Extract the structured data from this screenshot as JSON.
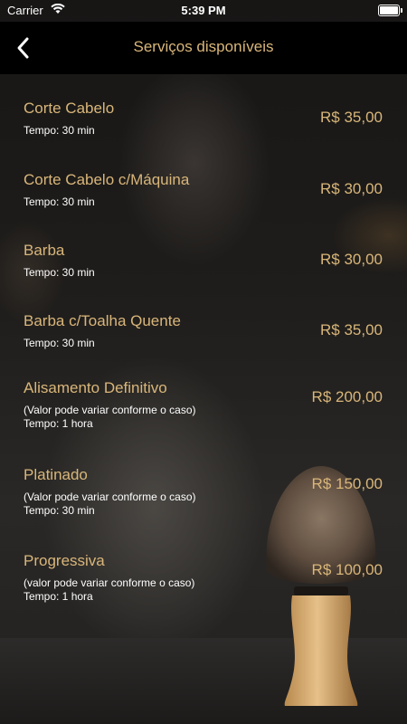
{
  "status_bar": {
    "carrier": "Carrier",
    "time": "5:39 PM"
  },
  "nav": {
    "title": "Serviços disponíveis",
    "back_icon": "chevron-left-icon"
  },
  "colors": {
    "accent": "#d9b67a",
    "nav_background": "#000000",
    "text": "#ffffff"
  },
  "services": [
    {
      "name": "Corte Cabelo",
      "price": "R$ 35,00",
      "note": "",
      "time": "Tempo: 30 min"
    },
    {
      "name": "Corte Cabelo c/Máquina",
      "price": "R$ 30,00",
      "note": "",
      "time": "Tempo: 30 min"
    },
    {
      "name": "Barba",
      "price": "R$ 30,00",
      "note": "",
      "time": "Tempo: 30 min"
    },
    {
      "name": "Barba c/Toalha Quente",
      "price": "R$ 35,00",
      "note": "",
      "time": "Tempo: 30 min"
    },
    {
      "name": "Alisamento Definitivo",
      "price": "R$ 200,00",
      "note": "(Valor pode variar conforme o caso)",
      "time": "Tempo: 1 hora"
    },
    {
      "name": "Platinado",
      "price": "R$ 150,00",
      "note": "(Valor pode variar conforme o caso)",
      "time": "Tempo: 30 min"
    },
    {
      "name": "Progressiva",
      "price": "R$ 100,00",
      "note": "(valor pode variar conforme o caso)",
      "time": "Tempo: 1 hora"
    }
  ]
}
